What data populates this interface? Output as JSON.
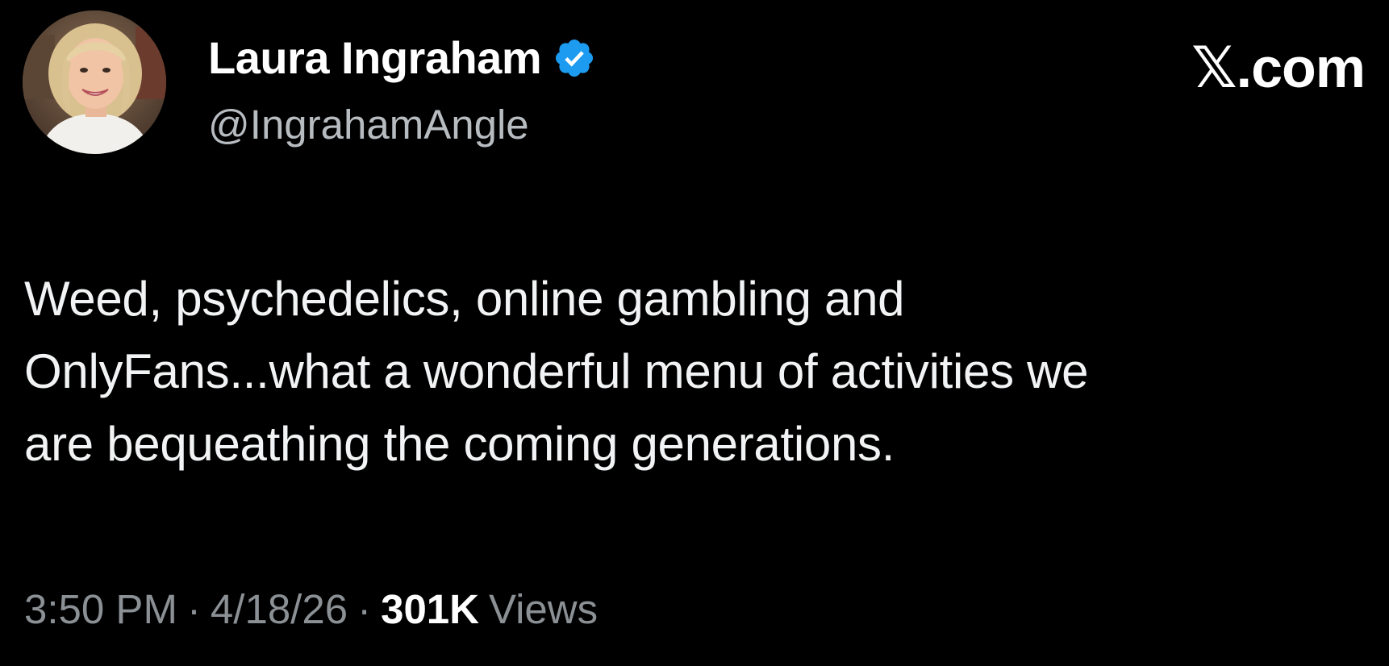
{
  "author": {
    "display_name": "Laura Ingraham",
    "handle": "@IngrahamAngle",
    "verified": true,
    "avatar_icon": "profile-photo"
  },
  "watermark": "𝕏.com",
  "tweet": {
    "text": "Weed, psychedelics, online gambling and\nOnlyFans...what a wonderful menu of activities we\nare bequeathing the coming generations."
  },
  "meta": {
    "time": "3:50 PM",
    "separator": "·",
    "date": "4/18/26",
    "views_count": "301K",
    "views_label": "Views"
  },
  "colors": {
    "background": "#000000",
    "verified_blue": "#1d9bf0",
    "secondary_text": "#8b9095"
  }
}
